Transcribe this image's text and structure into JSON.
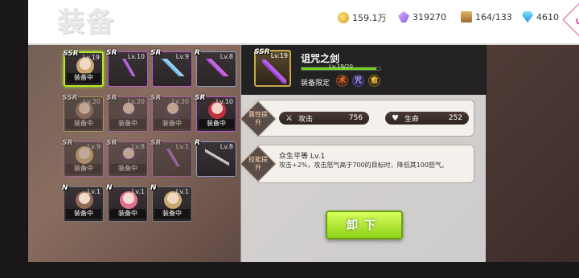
{
  "header": {
    "title": "装备",
    "resources": [
      {
        "icon": "gold-coin-icon",
        "value": "159.1万"
      },
      {
        "icon": "crystal-icon",
        "value": "319270"
      },
      {
        "icon": "treasure-box-icon",
        "value": "164/133"
      },
      {
        "icon": "diamond-icon",
        "value": "4610"
      }
    ],
    "back_icon": "back-arrow-icon"
  },
  "equipment": [
    {
      "rarity": "SSR",
      "level": "Lv.19",
      "tag": "装备中",
      "art": "face blonde",
      "selected": true,
      "dim": false
    },
    {
      "rarity": "SR",
      "level": "Lv.10",
      "tag": "",
      "art": "weapon3",
      "selected": false,
      "dim": false
    },
    {
      "rarity": "SR",
      "level": "Lv.9",
      "tag": "",
      "art": "weapon2",
      "selected": false,
      "dim": false
    },
    {
      "rarity": "R",
      "level": "Lv.8",
      "tag": "",
      "art": "weapon",
      "selected": false,
      "dim": false
    },
    {
      "rarity": "SSR",
      "level": "Lv.20",
      "tag": "装备中",
      "art": "face",
      "selected": false,
      "dim": true
    },
    {
      "rarity": "SR",
      "level": "Lv.20",
      "tag": "装备中",
      "art": "face dark",
      "selected": false,
      "dim": true
    },
    {
      "rarity": "SR",
      "level": "Lv.20",
      "tag": "装备中",
      "art": "face dark",
      "selected": false,
      "dim": true
    },
    {
      "rarity": "SR",
      "level": "Lv.10",
      "tag": "装备中",
      "art": "face red",
      "selected": false,
      "dim": false
    },
    {
      "rarity": "SR",
      "level": "Lv.9",
      "tag": "装备中",
      "art": "face blonde",
      "selected": false,
      "dim": true
    },
    {
      "rarity": "SR",
      "level": "Lv.8",
      "tag": "装备中",
      "art": "face dark",
      "selected": false,
      "dim": true
    },
    {
      "rarity": "SR",
      "level": "Lv.1",
      "tag": "",
      "art": "weapon3",
      "selected": false,
      "dim": true
    },
    {
      "rarity": "R",
      "level": "Lv.8",
      "tag": "",
      "art": "weapon4",
      "selected": false,
      "dim": false
    },
    {
      "rarity": "N",
      "level": "Lv.1",
      "tag": "装备中",
      "art": "face",
      "selected": false,
      "dim": false
    },
    {
      "rarity": "N",
      "level": "Lv.1",
      "tag": "装备中",
      "art": "face pink",
      "selected": false,
      "dim": false
    },
    {
      "rarity": "N",
      "level": "Lv.1",
      "tag": "装备中",
      "art": "face blonde",
      "selected": false,
      "dim": false
    }
  ],
  "detail": {
    "rarity": "SSR",
    "level": "Lv.19",
    "name": "诅咒之剑",
    "exp_text": "Lv.19/20",
    "exp_progress": 0.95,
    "equip_limit_label": "装备限定",
    "classes": [
      "术",
      "咒",
      "愈"
    ],
    "attr_label": "属性提升",
    "stats": [
      {
        "icon": "swords-icon",
        "label": "攻击",
        "value": "756"
      },
      {
        "icon": "heart-icon",
        "label": "生命",
        "value": "252"
      }
    ],
    "skill_label": "技能提升",
    "skill_title": "众生平等 Lv.1",
    "skill_desc": "攻击+2%，攻击怒气高于700的目标时，降低其100怒气。",
    "unequip_label": "卸下"
  }
}
